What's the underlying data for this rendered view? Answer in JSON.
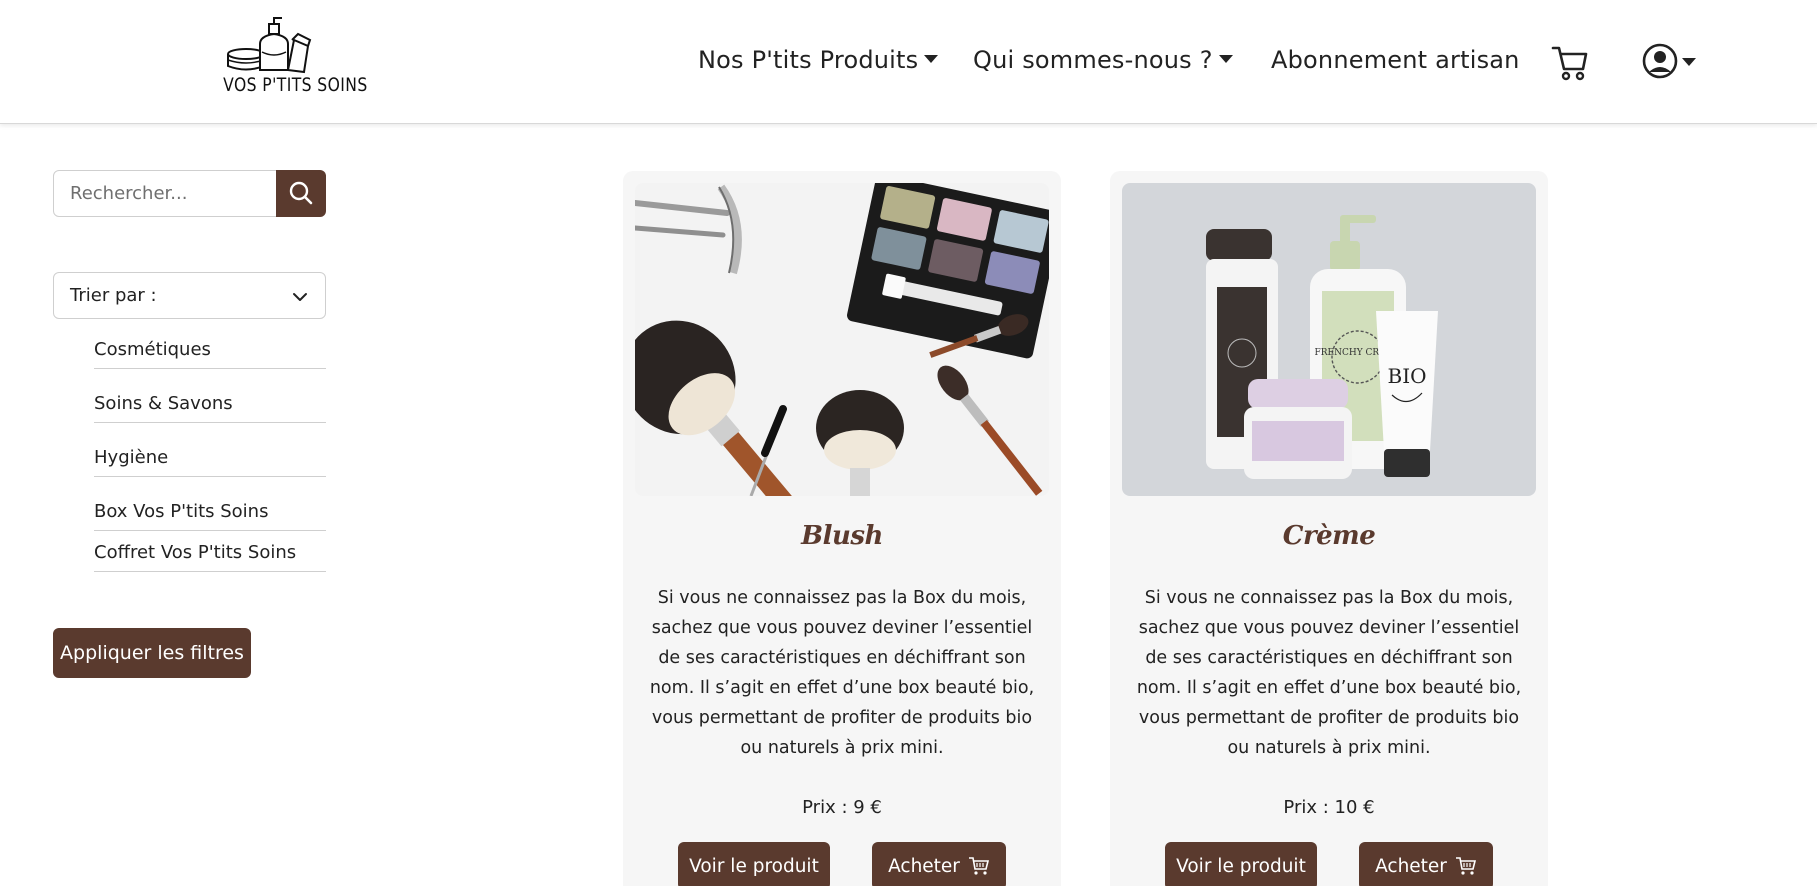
{
  "brand": {
    "logo_text": "VOS P'TITS SOINS",
    "accent_color": "#5a3a2e"
  },
  "nav": {
    "products_label": "Nos P'tits Produits",
    "about_label": "Qui sommes-nous ?",
    "subscription_label": "Abonnement artisan",
    "cart_icon": "shopping-cart-icon",
    "user_icon": "user-circle-icon"
  },
  "sidebar": {
    "search": {
      "placeholder": "Rechercher...",
      "value": ""
    },
    "sort": {
      "label": "Trier par :"
    },
    "categories": [
      {
        "label": "Cosmétiques"
      },
      {
        "label": "Soins & Savons"
      },
      {
        "label": "Hygiène"
      },
      {
        "label": "Box Vos P'tits Soins"
      },
      {
        "label": "Coffret Vos P'tits Soins"
      }
    ],
    "apply_label": "Appliquer les filtres"
  },
  "products": [
    {
      "title": "Blush",
      "description": "Si vous ne connaissez pas la Box du mois, sachez que vous pouvez deviner l’essentiel de ses caractéristiques en déchiffrant son nom. Il s’agit en effet d’une box beauté bio, vous permettant de profiter de produits bio ou naturels à prix mini.",
      "price": "Prix : 9 €",
      "view_label": "Voir le produit",
      "buy_label": "Acheter"
    },
    {
      "title": "Crème",
      "description": "Si vous ne connaissez pas la Box du mois, sachez que vous pouvez deviner l’essentiel de ses caractéristiques en déchiffrant son nom. Il s’agit en effet d’une box beauté bio, vous permettant de profiter de produits bio ou naturels à prix mini.",
      "price": "Prix : 10 €",
      "view_label": "Voir le produit",
      "buy_label": "Acheter"
    }
  ],
  "product_images": [
    {
      "palette": [
        {
          "label": ""
        },
        {
          "label": ""
        },
        {
          "label": ""
        },
        {
          "label": ""
        },
        {
          "label": ""
        },
        {
          "label": ""
        }
      ]
    },
    {
      "jar_label": "",
      "pump_label": "FRENCHY CREAM",
      "tube_label": "BIO"
    }
  ]
}
